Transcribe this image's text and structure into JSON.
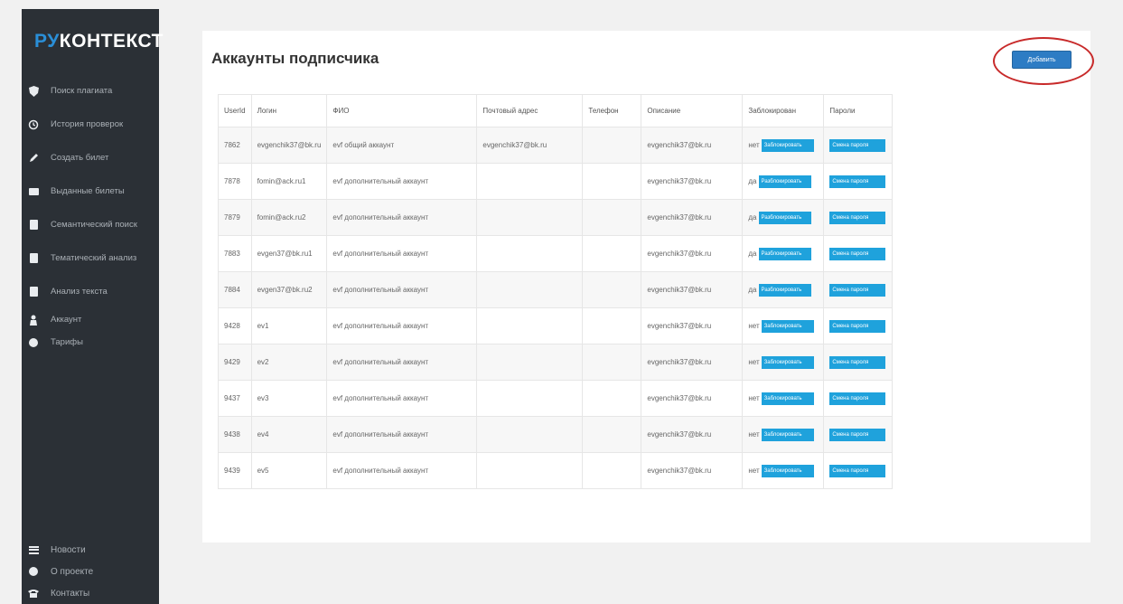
{
  "brand": {
    "prefix": "РУ",
    "suffix": "КОНТЕКСТ"
  },
  "sidebar": {
    "items": [
      {
        "label": "Поиск плагиата",
        "icon": "shield-icon"
      },
      {
        "label": "История проверок",
        "icon": "history-icon"
      },
      {
        "label": "Создать билет",
        "icon": "pencil-icon"
      },
      {
        "label": "Выданные билеты",
        "icon": "folder-icon"
      },
      {
        "label": "Семантический поиск",
        "icon": "document-icon"
      },
      {
        "label": "Тематический анализ",
        "icon": "document-icon"
      },
      {
        "label": "Анализ текста",
        "icon": "document-icon"
      },
      {
        "label": "Аккаунт",
        "icon": "user-icon"
      },
      {
        "label": "Тарифы",
        "icon": "circle-icon"
      }
    ],
    "bottom_items": [
      {
        "label": "Новости",
        "icon": "news-icon"
      },
      {
        "label": "О проекте",
        "icon": "info-icon"
      },
      {
        "label": "Контакты",
        "icon": "phone-icon"
      }
    ]
  },
  "page": {
    "title": "Аккаунты подписчика",
    "add_button": "Добавить"
  },
  "table": {
    "headers": [
      "UserId",
      "Логин",
      "ФИО",
      "Почтовый адрес",
      "Телефон",
      "Описание",
      "Заблокирован",
      "Пароли"
    ],
    "block_button": "Заблокировать",
    "unblock_button": "Разблокировать",
    "password_button": "Смена пароля",
    "rows": [
      {
        "id": "7862",
        "login": "evgenchik37@bk.ru",
        "fio": "evf общий аккаунт",
        "email": "evgenchik37@bk.ru",
        "phone": "",
        "desc": "evgenchik37@bk.ru",
        "blocked": "нет"
      },
      {
        "id": "7878",
        "login": "fomin@ack.ru1",
        "fio": "evf дополнительный аккаунт",
        "email": "",
        "phone": "",
        "desc": "evgenchik37@bk.ru",
        "blocked": "да"
      },
      {
        "id": "7879",
        "login": "fomin@ack.ru2",
        "fio": "evf дополнительный аккаунт",
        "email": "",
        "phone": "",
        "desc": "evgenchik37@bk.ru",
        "blocked": "да"
      },
      {
        "id": "7883",
        "login": "evgen37@bk.ru1",
        "fio": "evf дополнительный аккаунт",
        "email": "",
        "phone": "",
        "desc": "evgenchik37@bk.ru",
        "blocked": "да"
      },
      {
        "id": "7884",
        "login": "evgen37@bk.ru2",
        "fio": "evf дополнительный аккаунт",
        "email": "",
        "phone": "",
        "desc": "evgenchik37@bk.ru",
        "blocked": "да"
      },
      {
        "id": "9428",
        "login": "ev1",
        "fio": "evf дополнительный аккаунт",
        "email": "",
        "phone": "",
        "desc": "evgenchik37@bk.ru",
        "blocked": "нет"
      },
      {
        "id": "9429",
        "login": "ev2",
        "fio": "evf дополнительный аккаунт",
        "email": "",
        "phone": "",
        "desc": "evgenchik37@bk.ru",
        "blocked": "нет"
      },
      {
        "id": "9437",
        "login": "ev3",
        "fio": "evf дополнительный аккаунт",
        "email": "",
        "phone": "",
        "desc": "evgenchik37@bk.ru",
        "blocked": "нет"
      },
      {
        "id": "9438",
        "login": "ev4",
        "fio": "evf дополнительный аккаунт",
        "email": "",
        "phone": "",
        "desc": "evgenchik37@bk.ru",
        "blocked": "нет"
      },
      {
        "id": "9439",
        "login": "ev5",
        "fio": "evf дополнительный аккаунт",
        "email": "",
        "phone": "",
        "desc": "evgenchik37@bk.ru",
        "blocked": "нет"
      }
    ]
  },
  "colors": {
    "sidebar_bg": "#2b3036",
    "brand_accent": "#2a8fd8",
    "button_blue": "#1fa2dc",
    "primary_button": "#2d7cc4",
    "highlight_circle": "#c82a2a"
  }
}
